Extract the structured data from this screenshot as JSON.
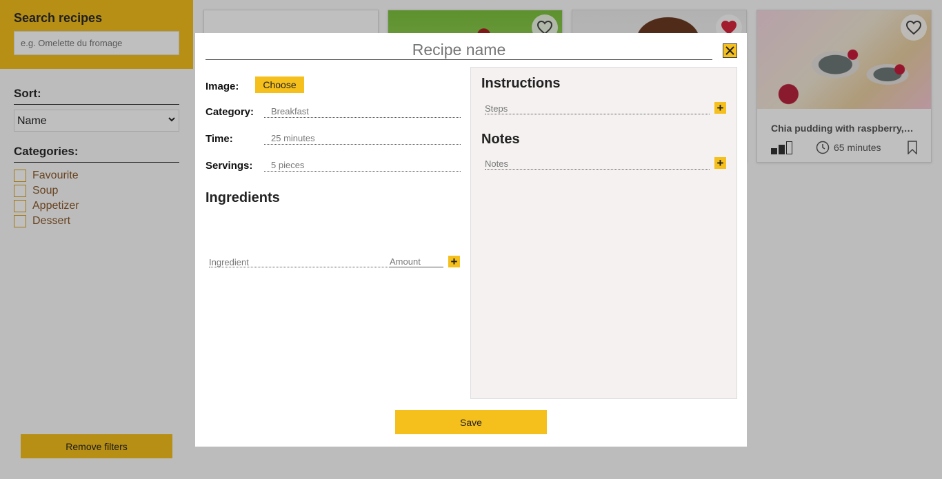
{
  "sidebar": {
    "search_title": "Search recipes",
    "search_placeholder": "e.g. Omelette du fromage",
    "sort_title": "Sort:",
    "sort_selected": "Name",
    "categories_title": "Categories:",
    "categories": [
      "Favourite",
      "Soup",
      "Appetizer",
      "Dessert"
    ],
    "remove_filters_label": "Remove filters"
  },
  "cards": [
    {
      "image": "muffins",
      "favourite": false
    },
    {
      "image": "cake",
      "favourite": true
    },
    {
      "image": "chia-pudding",
      "favourite": false,
      "title": "Chia pudding with raspberry,blu...",
      "time": "65 minutes",
      "difficulty": "2 of 3"
    }
  ],
  "modal": {
    "recipe_name_placeholder": "Recipe name",
    "image_label": "Image:",
    "choose_label": "Choose",
    "category_label": "Category:",
    "category_placeholder": "Breakfast",
    "time_label": "Time:",
    "time_placeholder": "25 minutes",
    "servings_label": "Servings:",
    "servings_placeholder": "5 pieces",
    "ingredients_title": "Ingredients",
    "ingredient_placeholder": "Ingredient",
    "amount_placeholder": "Amount",
    "instructions_title": "Instructions",
    "steps_placeholder": "Steps",
    "notes_title": "Notes",
    "notes_placeholder": "Notes",
    "save_label": "Save"
  },
  "colors": {
    "accent": "#f5bf1c",
    "favourite_heart": "#d7263d",
    "overlay": "rgba(0,0,0,0.25)",
    "right_panel": "#f4f1f0"
  }
}
